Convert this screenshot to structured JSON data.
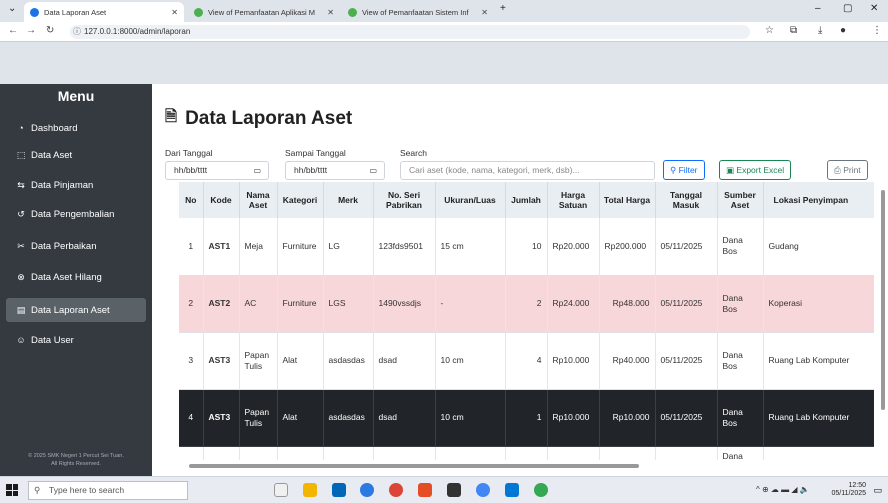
{
  "browser": {
    "tabs": [
      {
        "title": "Data Laporan Aset",
        "active": true
      },
      {
        "title": "View of Pemanfaatan Aplikasi M",
        "active": false
      },
      {
        "title": "View of Pemanfaatan Sistem Inf",
        "active": false
      }
    ],
    "url": "127.0.0.1:8000/admin/laporan"
  },
  "sidebar": {
    "title": "Menu",
    "items": [
      {
        "label": "Dashboard",
        "icon": "dashboard-icon"
      },
      {
        "label": "Data Aset",
        "icon": "box-icon"
      },
      {
        "label": "Data Pinjaman",
        "icon": "exchange-icon"
      },
      {
        "label": "Data Pengembalian",
        "icon": "return-icon"
      },
      {
        "label": "Data Perbaikan",
        "icon": "tools-icon"
      },
      {
        "label": "Data Aset Hilang",
        "icon": "x-circle-icon"
      },
      {
        "label": "Data Laporan Aset",
        "icon": "report-icon",
        "active": true
      },
      {
        "label": "Data User",
        "icon": "users-icon"
      }
    ],
    "footer_line1": "© 2025 SMK Negeri 1 Percut Sei Tuan.",
    "footer_line2": "All Rights Reserved."
  },
  "page": {
    "title": "Data Laporan Aset",
    "filters": {
      "from_label": "Dari Tanggal",
      "from_value": "hh/bb/tttt",
      "to_label": "Sampai Tanggal",
      "to_value": "hh/bb/tttt",
      "search_label": "Search",
      "search_placeholder": "Cari aset (kode, nama, kategori, merk, dsb)..."
    },
    "buttons": {
      "filter": "Filter",
      "export": "Export Excel",
      "print": "Print"
    }
  },
  "table": {
    "headers": [
      "No",
      "Kode",
      "Nama Aset",
      "Kategori",
      "Merk",
      "No. Seri Pabrikan",
      "Ukuran/Luas",
      "Jumlah",
      "Harga Satuan",
      "Total Harga",
      "Tanggal Masuk",
      "Sumber Aset",
      "Lokasi Penyimpan"
    ],
    "rows": [
      [
        "1",
        "AST1",
        "Meja",
        "Furniture",
        "LG",
        "123fds9501",
        "15 cm",
        "10",
        "Rp20.000",
        "Rp200.000",
        "05/11/2025",
        "Dana Bos",
        "Gudang"
      ],
      [
        "2",
        "AST2",
        "AC",
        "Furniture",
        "LGS",
        "1490vssdjs",
        "-",
        "2",
        "Rp24.000",
        "Rp48.000",
        "05/11/2025",
        "Dana Bos",
        "Koperasi"
      ],
      [
        "3",
        "AST3",
        "Papan Tulis",
        "Alat",
        "asdasdas",
        "dsad",
        "10 cm",
        "4",
        "Rp10.000",
        "Rp40.000",
        "05/11/2025",
        "Dana Bos",
        "Ruang Lab Komputer"
      ],
      [
        "4",
        "AST3",
        "Papan Tulis",
        "Alat",
        "asdasdas",
        "dsad",
        "10 cm",
        "1",
        "Rp10.000",
        "Rp10.000",
        "05/11/2025",
        "Dana Bos",
        "Ruang Lab Komputer"
      ],
      [
        "",
        "",
        "",
        "",
        "",
        "",
        "",
        "",
        "",
        "",
        "",
        "Dana",
        ""
      ]
    ]
  },
  "taskbar": {
    "search_placeholder": "Type here to search",
    "time": "12:50",
    "date": "05/11/2025"
  }
}
